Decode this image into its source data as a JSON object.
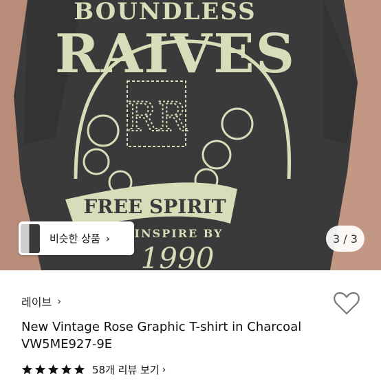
{
  "product_image": {
    "graphic_top_text": "BOUNDLESS",
    "graphic_main_text": "RAIVES",
    "graphic_monogram": "RR",
    "graphic_banner_text": "FREE SPIRIT",
    "graphic_sub_text": "INSPIRE BY",
    "graphic_year": "1990",
    "similar_button_label": "비슷한 상품",
    "counter_text": "3 / 3"
  },
  "product_info": {
    "brand_label": "레이브",
    "title": "New Vintage Rose Graphic T-shirt in Charcoal VW5ME927-9E",
    "rating": 5,
    "rating_max": 5,
    "review_link_label": "58개 리뷰 보기"
  },
  "colors": {
    "shirt": "#3b3b3b",
    "print": "#d8dcb8",
    "skin": "#b88b78"
  },
  "icons": {
    "heart": "heart-outline-icon",
    "chevron": "chevron-right-icon",
    "star": "star-filled-icon"
  }
}
